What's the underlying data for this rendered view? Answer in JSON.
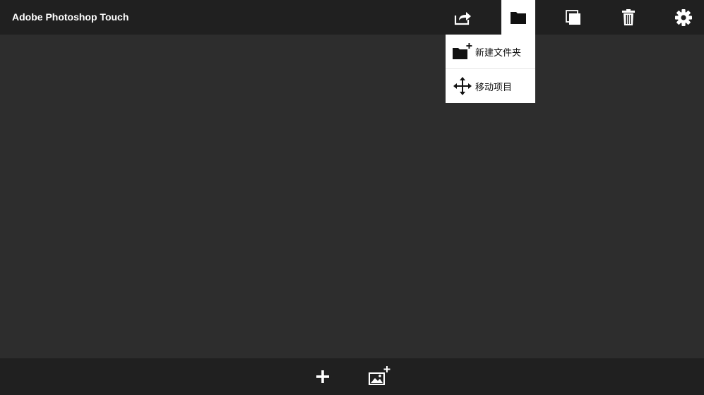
{
  "app": {
    "title": "Adobe Photoshop Touch"
  },
  "toolbar": {
    "items": [
      {
        "name": "share",
        "icon": "share-icon"
      },
      {
        "name": "folder",
        "icon": "folder-icon",
        "active": true
      },
      {
        "name": "duplicate",
        "icon": "duplicate-icon"
      },
      {
        "name": "delete",
        "icon": "trash-icon"
      },
      {
        "name": "settings",
        "icon": "gear-icon"
      }
    ]
  },
  "folder_menu": {
    "items": [
      {
        "label": "新建文件夹",
        "icon": "new-folder-icon"
      },
      {
        "label": "移动项目",
        "icon": "move-icon"
      }
    ]
  },
  "bottom_bar": {
    "items": [
      {
        "name": "new-project",
        "icon": "plus-icon"
      },
      {
        "name": "import-image",
        "icon": "add-image-icon"
      }
    ]
  },
  "colors": {
    "topbar": "#202020",
    "canvas": "#2d2d2d",
    "menu_bg": "#ffffff",
    "icon": "#ffffff"
  }
}
